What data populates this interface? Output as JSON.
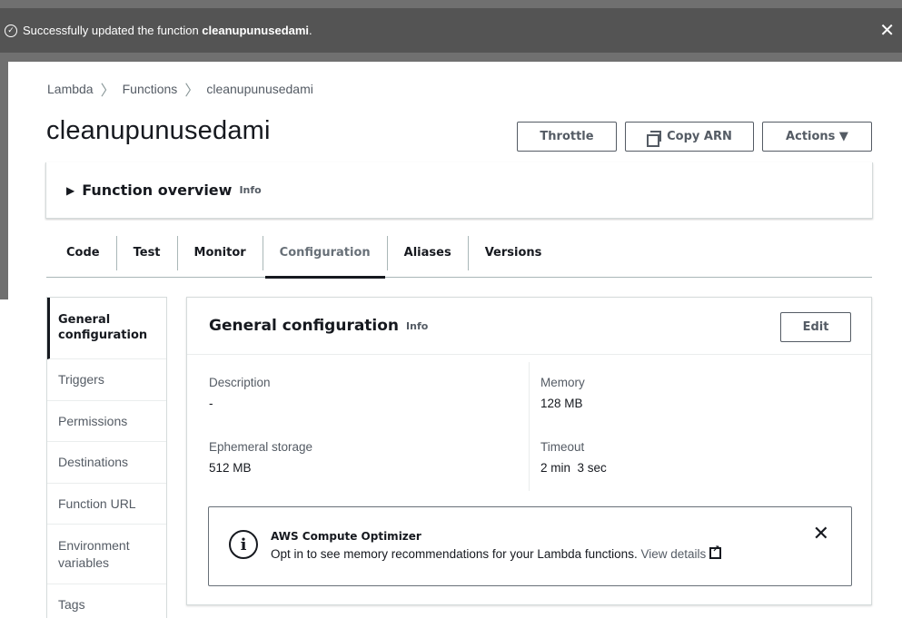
{
  "flash": {
    "message_prefix": "Successfully updated the function ",
    "function_name": "cleanupunusedami",
    "message_suffix": ".",
    "close_label": "✕"
  },
  "breadcrumb": [
    "Lambda",
    "Functions",
    "cleanupunusedami"
  ],
  "page_title": "cleanupunusedami",
  "header_buttons": {
    "throttle": "Throttle",
    "copy_arn": "Copy ARN",
    "actions": "Actions ▼"
  },
  "overview": {
    "title": "Function overview",
    "info": "Info"
  },
  "tabs": [
    "Code",
    "Test",
    "Monitor",
    "Configuration",
    "Aliases",
    "Versions"
  ],
  "active_tab": "Configuration",
  "sidenav": [
    "General configuration",
    "Triggers",
    "Permissions",
    "Destinations",
    "Function URL",
    "Environment variables",
    "Tags"
  ],
  "panel": {
    "title": "General configuration",
    "info": "Info",
    "edit_label": "Edit",
    "fields": {
      "description_label": "Description",
      "description_value": "-",
      "memory_label": "Memory",
      "memory_value": "128 MB",
      "ephemeral_label": "Ephemeral storage",
      "ephemeral_value": "512 MB",
      "timeout_label": "Timeout",
      "timeout_value": "2 min  3 sec"
    }
  },
  "notice": {
    "title": "AWS Compute Optimizer",
    "text": "Opt in to see memory recommendations for your Lambda functions.",
    "link": "View details",
    "close": "✕"
  },
  "icons": {
    "success": "check-circle-icon",
    "copy": "copy-icon",
    "info": "info-circle-icon",
    "external": "external-link-icon"
  }
}
